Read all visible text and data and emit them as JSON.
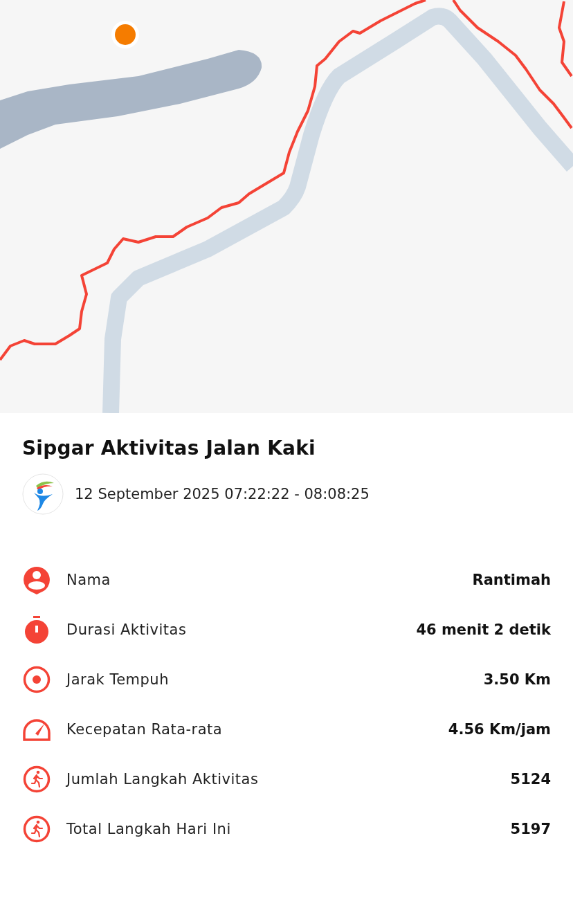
{
  "activity": {
    "title": "Sipgar Aktivitas Jalan Kaki",
    "datetime": "12 September 2025 07:22:22 - 08:08:25"
  },
  "stats": [
    {
      "kind": "person",
      "label": "Nama",
      "value": "Rantimah"
    },
    {
      "kind": "timer",
      "label": "Durasi Aktivitas",
      "value": "46 menit 2 detik"
    },
    {
      "kind": "target",
      "label": "Jarak Tempuh",
      "value": "3.50 Km"
    },
    {
      "kind": "speed",
      "label": "Kecepatan Rata-rata",
      "value": "4.56 Km/jam"
    },
    {
      "kind": "walk",
      "label": "Jumlah Langkah Aktivitas",
      "value": "5124"
    },
    {
      "kind": "walk",
      "label": "Total Langkah Hari Ini",
      "value": "5197"
    }
  ]
}
